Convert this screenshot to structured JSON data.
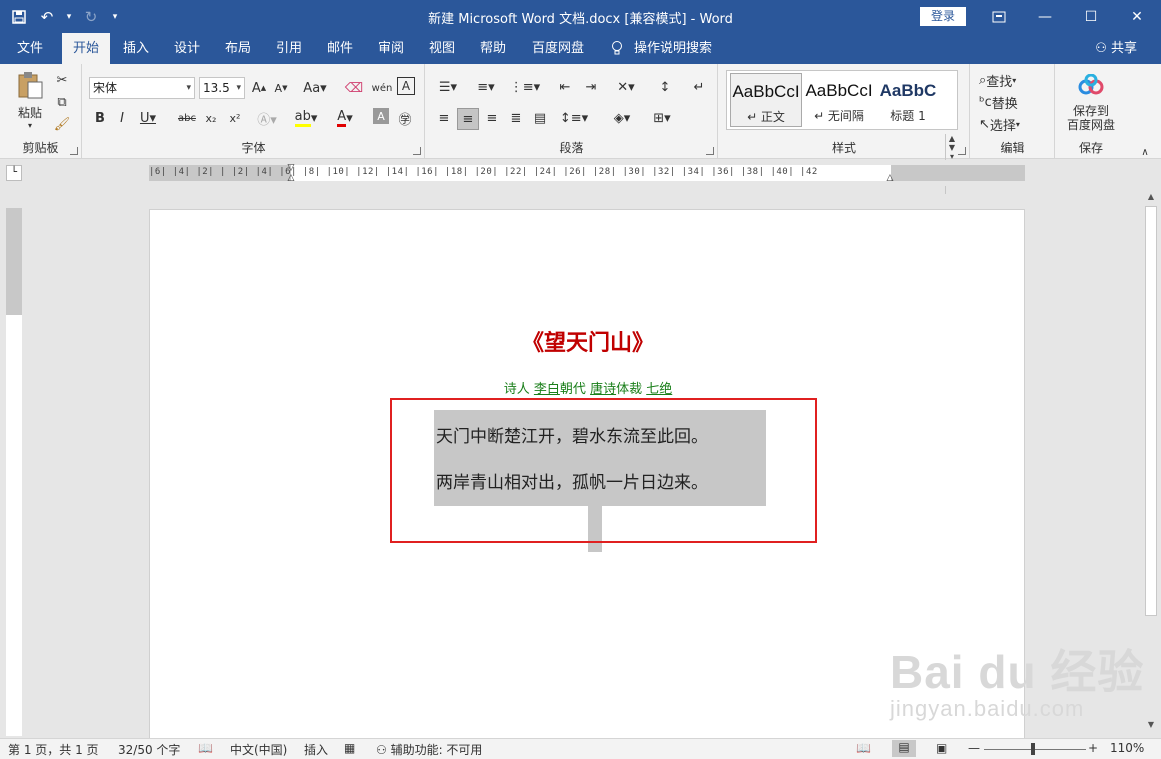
{
  "titlebar": {
    "title": "新建 Microsoft Word 文档.docx [兼容模式]  -  Word",
    "login": "登录"
  },
  "tabs": [
    "文件",
    "开始",
    "插入",
    "设计",
    "布局",
    "引用",
    "邮件",
    "审阅",
    "视图",
    "帮助",
    "百度网盘",
    "操作说明搜索"
  ],
  "share": "共享",
  "ribbon": {
    "clipboard": {
      "label": "剪贴板",
      "paste": "粘贴"
    },
    "font": {
      "label": "字体",
      "name": "宋体",
      "size": "13.5"
    },
    "paragraph": {
      "label": "段落"
    },
    "styles": {
      "label": "样式",
      "items": [
        {
          "sample": "AaBbCcI",
          "name": "↵ 正文"
        },
        {
          "sample": "AaBbCcI",
          "name": "↵ 无间隔"
        },
        {
          "sample": "AaBbC",
          "name": "标题 1"
        }
      ]
    },
    "editing": {
      "label": "编辑",
      "find": "查找",
      "replace": "替换",
      "select": "选择"
    },
    "save": {
      "label": "保存",
      "button": "保存到\n百度网盘"
    }
  },
  "ruler": {
    "numbers": "|6| |4| |2| |    |2| |4| |6| |8| |10| |12| |14| |16| |18| |20| |22| |24| |26| |28| |30| |32| |34| |36| |38| |40| |42"
  },
  "document": {
    "title": "《望天门山》",
    "meta": {
      "poet_label": "诗人",
      "poet": "李白",
      "dynasty_label": "朝代",
      "dynasty": "唐诗",
      "form_label": "体裁",
      "form": "七绝"
    },
    "lines": [
      "天门中断楚江开，碧水东流至此回。",
      "两岸青山相对出，孤帆一片日边来。"
    ]
  },
  "watermark": {
    "main": "Bai du 经验",
    "sub": "jingyan.baidu.com"
  },
  "status": {
    "page": "第 1 页，共 1 页",
    "words": "32/50 个字",
    "language": "中文(中国)",
    "mode": "插入",
    "accessibility": "辅助功能: 不可用",
    "zoom": "110%"
  }
}
